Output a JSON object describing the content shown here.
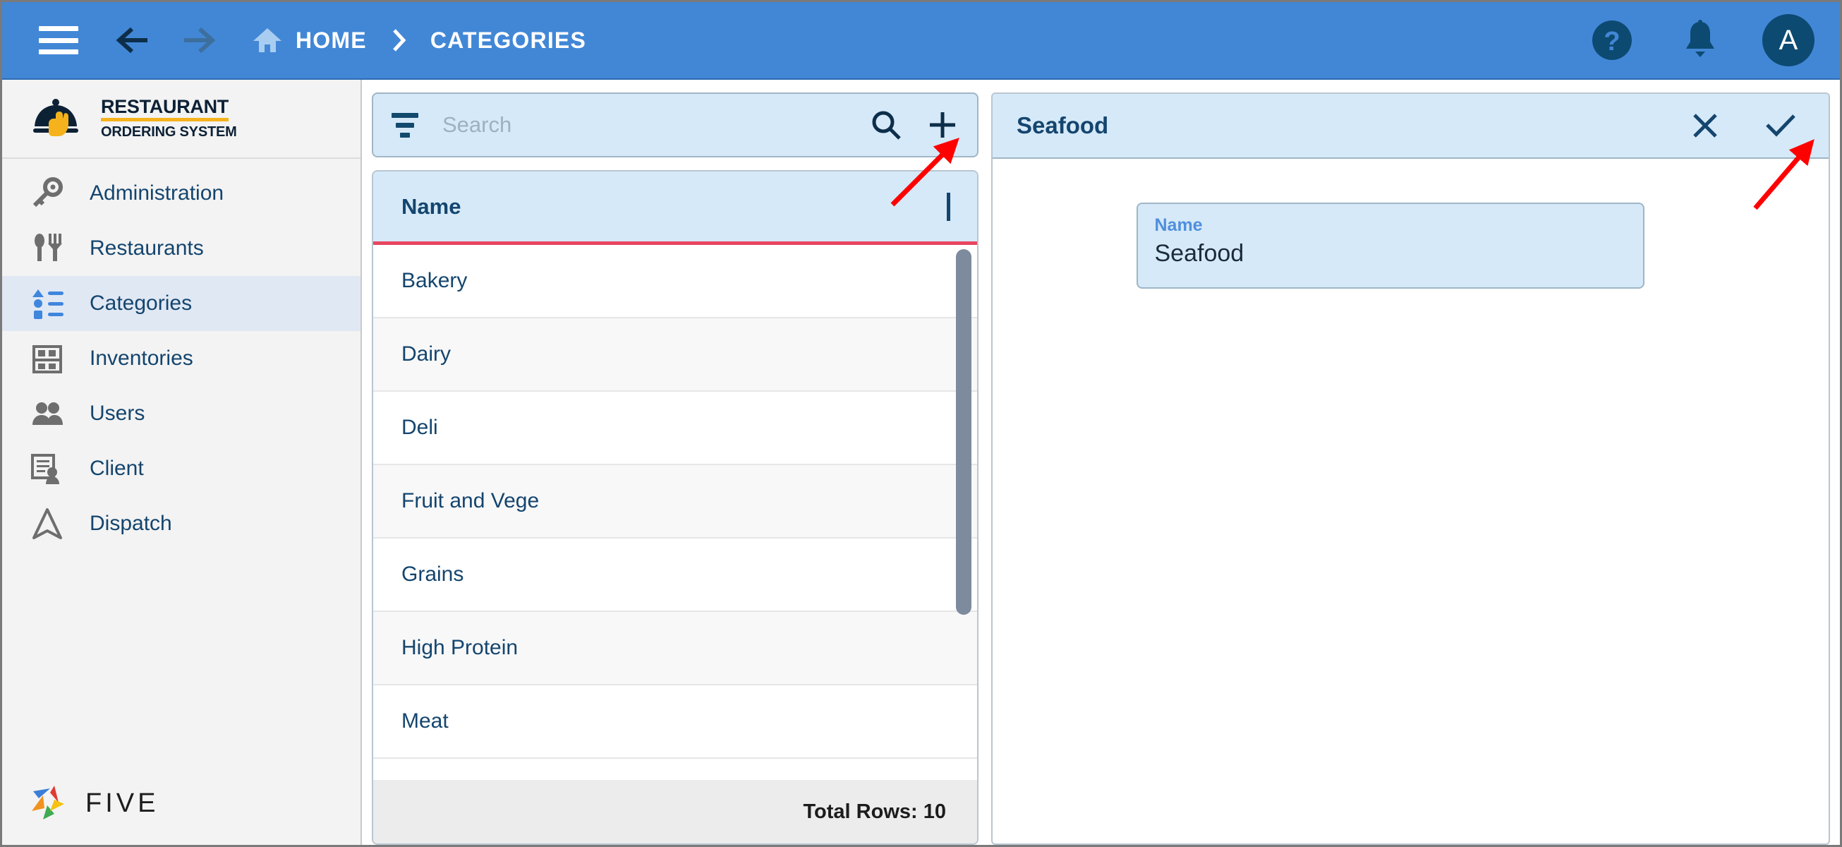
{
  "topbar": {
    "menu_icon": "hamburger-icon",
    "back_icon": "arrow-back-icon",
    "forward_icon": "arrow-forward-icon",
    "home_icon": "home-icon",
    "breadcrumb": [
      {
        "label": "HOME"
      },
      {
        "label": "CATEGORIES"
      }
    ],
    "separator": "chevron-right-icon",
    "help_icon": "help-circle-icon",
    "bell_icon": "notification-bell-icon",
    "avatar_initial": "A",
    "background_color": "#4287d6",
    "avatar_color": "#0d4a72"
  },
  "sidebar": {
    "logo": {
      "line1": "RESTAURANT",
      "line2": "ORDERING SYSTEM",
      "icon": "cloche-hand-icon",
      "underline_color": "#f5b21c"
    },
    "items": [
      {
        "label": "Administration",
        "icon": "key-icon",
        "active": false
      },
      {
        "label": "Restaurants",
        "icon": "cutlery-icon",
        "active": false
      },
      {
        "label": "Categories",
        "icon": "category-list-icon",
        "active": true
      },
      {
        "label": "Inventories",
        "icon": "shelf-icon",
        "active": false
      },
      {
        "label": "Users",
        "icon": "users-icon",
        "active": false
      },
      {
        "label": "Client",
        "icon": "client-card-icon",
        "active": false
      },
      {
        "label": "Dispatch",
        "icon": "dispatch-arrow-icon",
        "active": false
      }
    ],
    "footer_logo": {
      "text": "FIVE",
      "icon": "five-pinwheel-icon",
      "colors": [
        "#3b7dd8",
        "#e03b33",
        "#f0921f",
        "#3eab54",
        "#f5c211"
      ]
    },
    "active_background": "#e0e8f4"
  },
  "list_panel": {
    "search": {
      "filter_icon": "filter-icon",
      "placeholder": "Search",
      "value": "",
      "search_icon": "search-icon",
      "add_icon": "plus-icon"
    },
    "grid": {
      "columns": [
        "Name"
      ],
      "rows": [
        {
          "name": "Bakery"
        },
        {
          "name": "Dairy"
        },
        {
          "name": "Deli"
        },
        {
          "name": "Fruit and Vege"
        },
        {
          "name": "Grains"
        },
        {
          "name": "High Protein"
        },
        {
          "name": "Meat"
        }
      ],
      "header_underline_color": "#e8465f",
      "footer_text": "Total Rows: 10"
    }
  },
  "detail_panel": {
    "title": "Seafood",
    "close_icon": "close-x-icon",
    "confirm_icon": "check-icon",
    "fields": [
      {
        "label": "Name",
        "value": "Seafood"
      }
    ]
  },
  "annotations": {
    "arrow_color": "#ff0000",
    "arrow_1_target": "plus-icon",
    "arrow_2_target": "check-icon"
  }
}
